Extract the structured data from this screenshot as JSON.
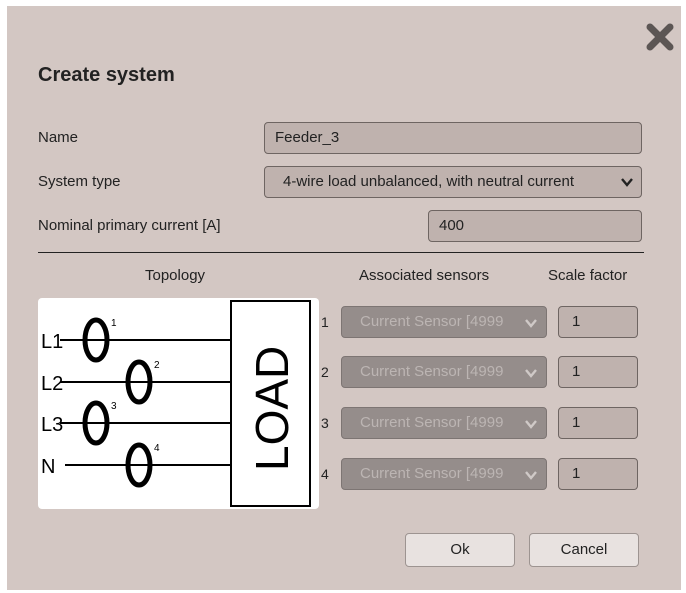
{
  "dialog": {
    "title": "Create system",
    "close_icon": "close-x-icon"
  },
  "form": {
    "name_label": "Name",
    "name_value": "Feeder_3",
    "system_type_label": "System type",
    "system_type_value": "4-wire load unbalanced, with neutral current",
    "nominal_current_label": "Nominal primary current [A]",
    "nominal_current_value": "400"
  },
  "columns": {
    "topology": "Topology",
    "associated_sensors": "Associated sensors",
    "scale_factor": "Scale factor"
  },
  "topology_diagram": {
    "load_label": "LOAD",
    "lines": [
      "L1",
      "L2",
      "L3",
      "N"
    ],
    "sensor_numbers": [
      "1",
      "2",
      "3",
      "4"
    ]
  },
  "sensor_rows": [
    {
      "number": "1",
      "sensor": "Current Sensor [4999",
      "scale": "1"
    },
    {
      "number": "2",
      "sensor": "Current Sensor [4999",
      "scale": "1"
    },
    {
      "number": "3",
      "sensor": "Current Sensor [4999",
      "scale": "1"
    },
    {
      "number": "4",
      "sensor": "Current Sensor [4999",
      "scale": "1"
    }
  ],
  "buttons": {
    "ok": "Ok",
    "cancel": "Cancel"
  },
  "colors": {
    "dialog_background": "#d3c7c3",
    "field_background": "#bfb2ae",
    "disabled_select": "#958d8b",
    "button_background": "#e8e2e0"
  }
}
